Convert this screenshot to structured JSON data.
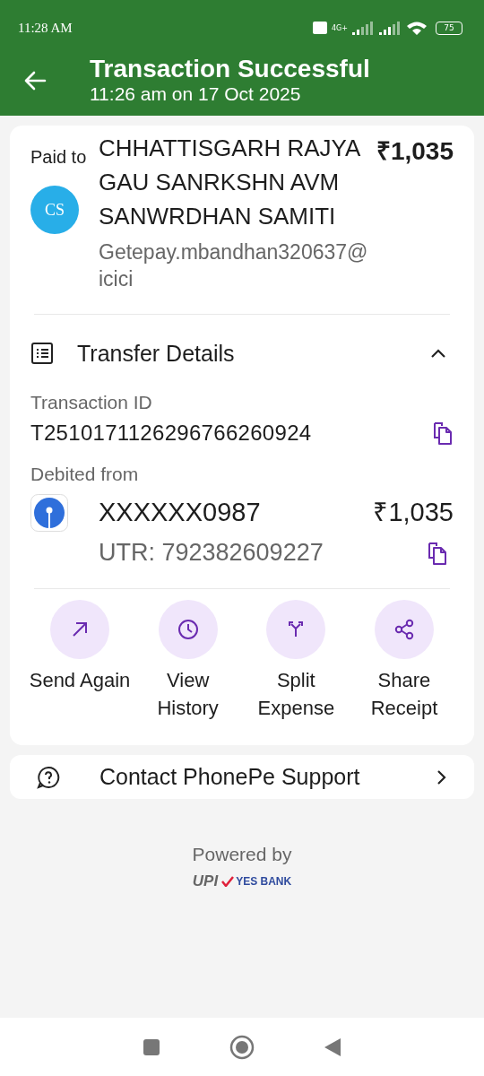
{
  "status_bar": {
    "time": "11:28 AM",
    "network": "4G+",
    "battery": "75"
  },
  "header": {
    "title": "Transaction Successful",
    "subtitle": "11:26 am on 17 Oct 2025"
  },
  "payment": {
    "label": "Paid to",
    "avatar": "CS",
    "payee": "CHHATTISGARH RAJYA GAU SANRKSHN AVM SANWRDHAN SAMITI",
    "upi_id": "Getepay.mbandhan320637@icici",
    "amount": "₹1,035"
  },
  "transfer_details": {
    "title": "Transfer Details",
    "expanded": true,
    "transaction_id_label": "Transaction ID",
    "transaction_id": "T2510171126296766260924",
    "debited_label": "Debited from",
    "account": "XXXXXX0987",
    "amount": "₹1,035",
    "utr": "UTR: 792382609227"
  },
  "actions": [
    {
      "kind": "send",
      "label": "Send Again"
    },
    {
      "kind": "history",
      "label": "View History"
    },
    {
      "kind": "split",
      "label": "Split Expense"
    },
    {
      "kind": "share",
      "label": "Share Receipt"
    }
  ],
  "support": {
    "label": "Contact PhonePe Support"
  },
  "footer": {
    "powered_by": "Powered by",
    "upi_logo": "UPI",
    "bank_logo": "YES BANK"
  }
}
